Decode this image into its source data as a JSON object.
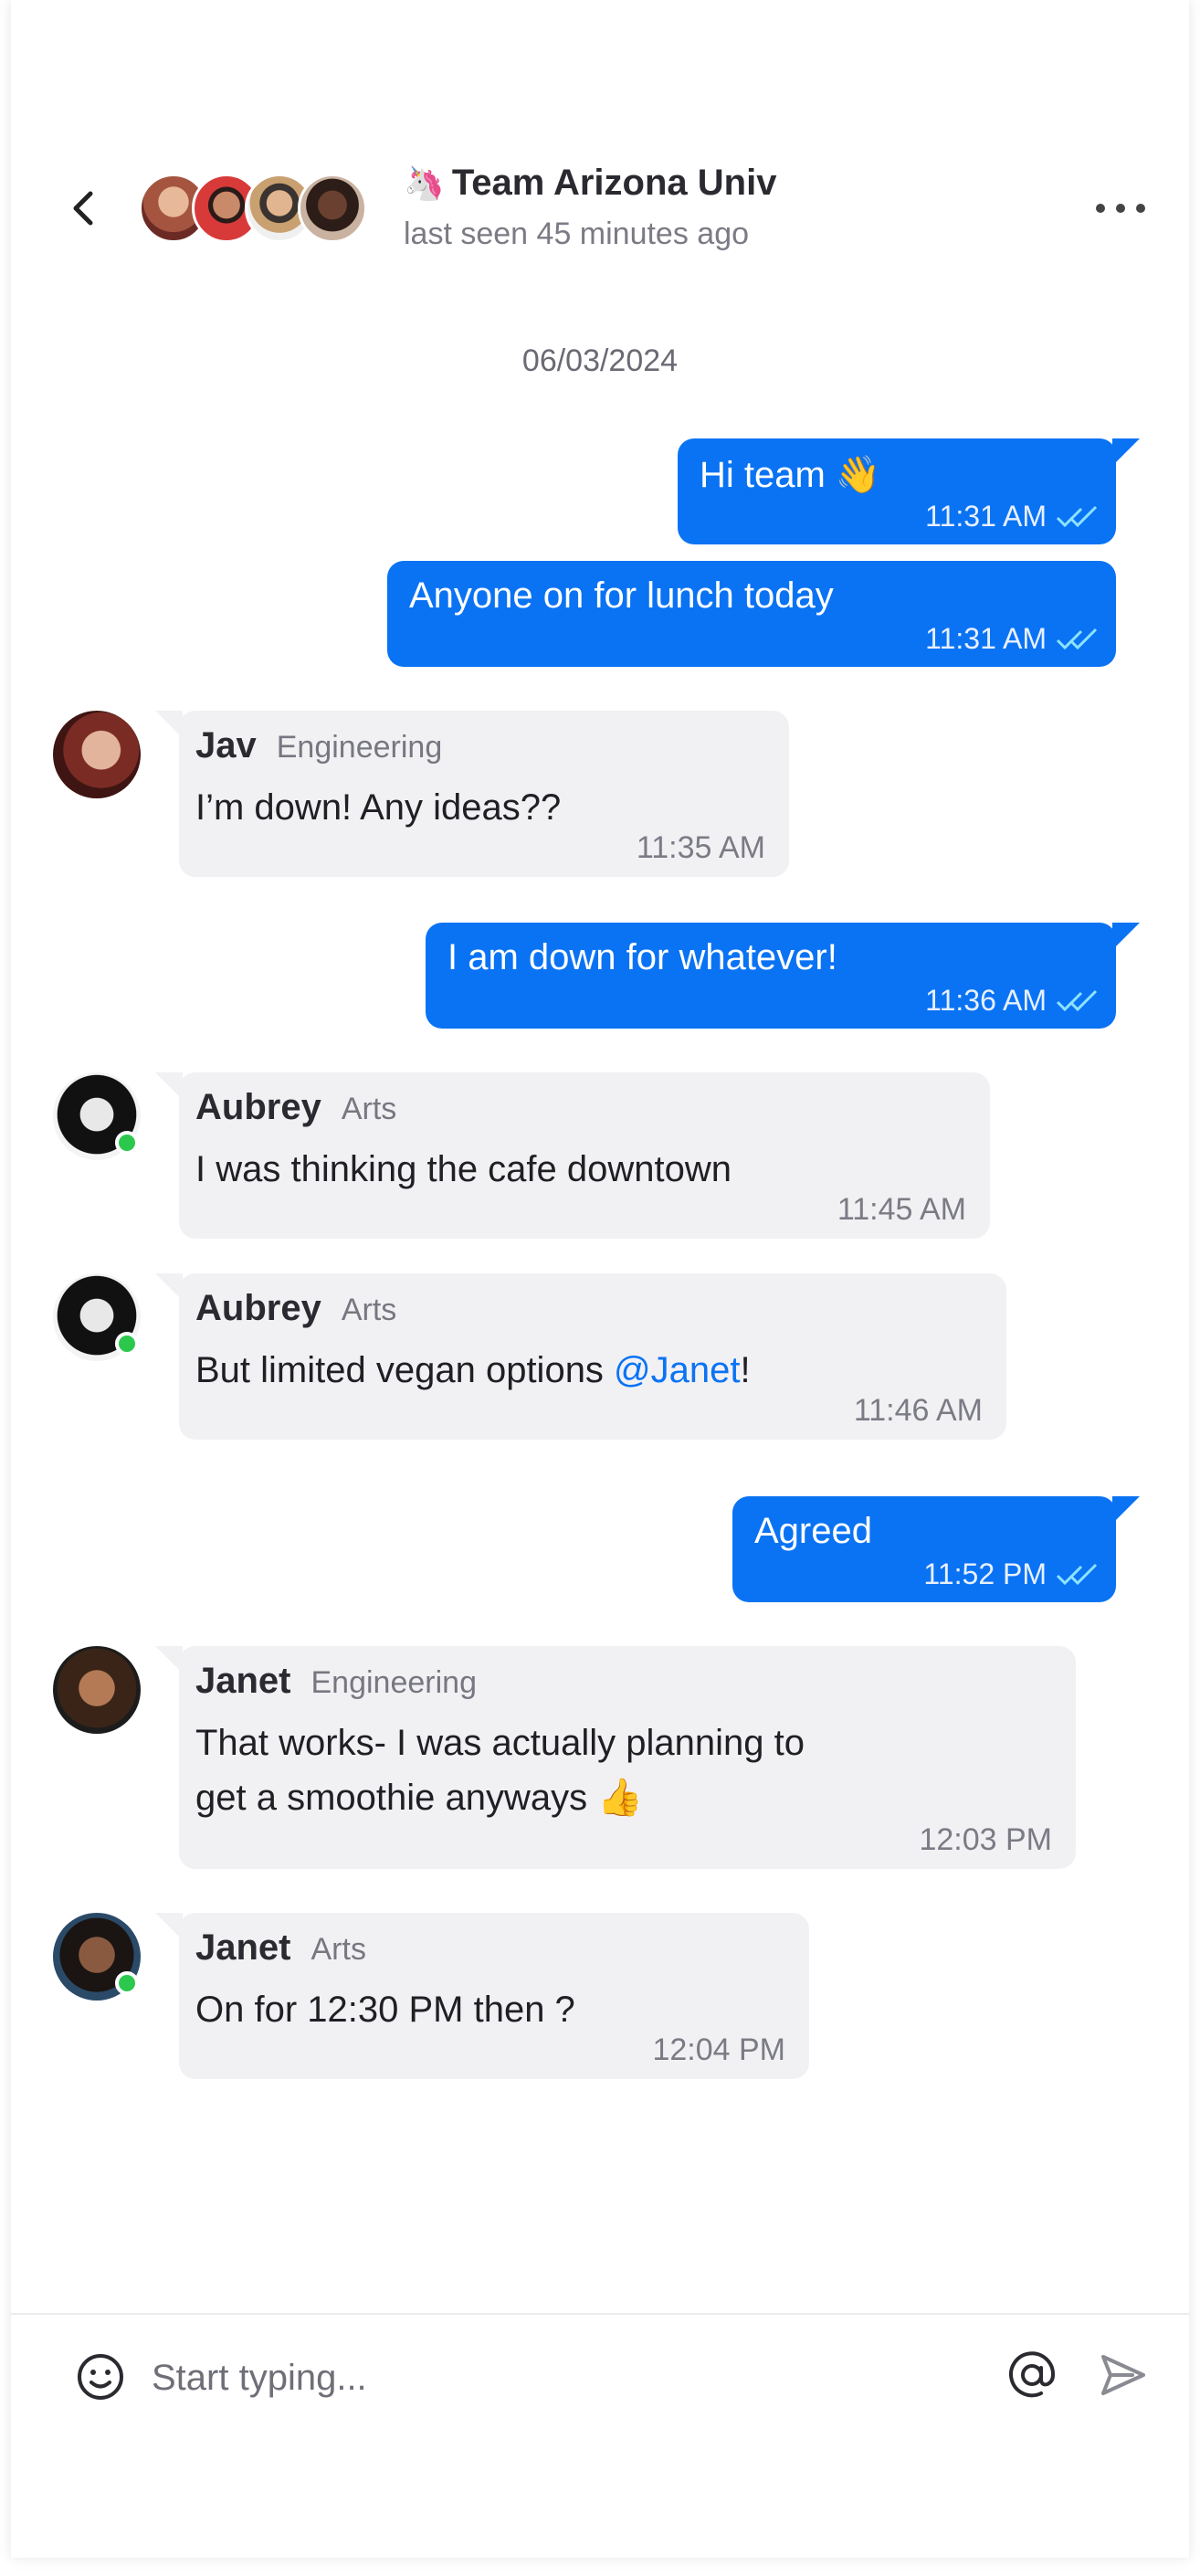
{
  "header": {
    "title_emoji": "🦄",
    "title": "Team Arizona Univ",
    "subtitle": "last seen 45 minutes ago"
  },
  "date": "06/03/2024",
  "messages": [
    {
      "text": "Hi team 👋",
      "time": "11:31 AM"
    },
    {
      "text": "Anyone on for lunch today",
      "time": "11:31 AM"
    },
    {
      "name": "Jav",
      "dept": "Engineering",
      "text": "I’m down! Any ideas??",
      "time": "11:35 AM"
    },
    {
      "text": "I am down for whatever!",
      "time": "11:36 AM"
    },
    {
      "name": "Aubrey",
      "dept": "Arts",
      "text": "I was thinking the cafe downtown",
      "time": "11:45 AM"
    },
    {
      "name": "Aubrey",
      "dept": "Arts",
      "text_before": "But limited vegan options ",
      "mention": "@Janet",
      "text_after": "!",
      "time": "11:46 AM"
    },
    {
      "text": "Agreed",
      "time": "11:52 PM"
    },
    {
      "name": "Janet",
      "dept": "Engineering",
      "text_line1": "That works- I was actually planning to",
      "text_line2": "get a smoothie anyways 👍",
      "time": "12:03 PM"
    },
    {
      "name": "Janet",
      "dept": "Arts",
      "text": "On for 12:30 PM then ?",
      "time": "12:04 PM"
    }
  ],
  "composer": {
    "placeholder": "Start typing..."
  },
  "colors": {
    "outgoing_bubble": "#0a73f4",
    "incoming_bubble": "#f1f1f4",
    "online": "#2cc84d",
    "read_check": "#8de3ff"
  }
}
